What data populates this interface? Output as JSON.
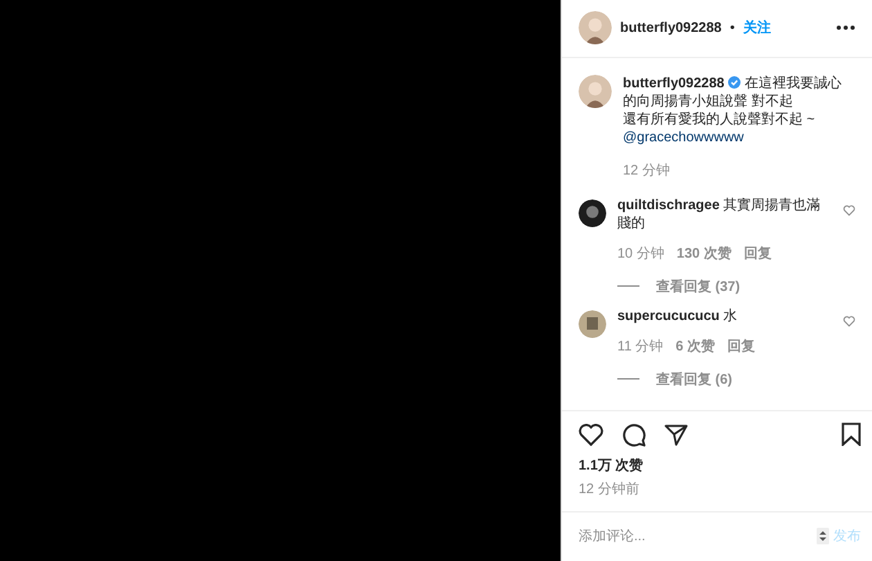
{
  "post": {
    "author": {
      "username": "butterfly092288",
      "separator": "•",
      "follow": "关注"
    },
    "caption": {
      "username": "butterfly092288",
      "verified": true,
      "text": "在這裡我要誠心的向周揚青小姐說聲 對不起",
      "text_2": "還有所有愛我的人說聲對不起 ~",
      "mention": "@gracechowwwww",
      "time": "12 分钟"
    },
    "comments": [
      {
        "username": "quiltdischragee",
        "text": "其實周揚青也滿賤的",
        "time": "10 分钟",
        "likes": "130 次赞",
        "reply": "回复",
        "view_replies": "查看回复 (37)",
        "liked": false
      },
      {
        "username": "supercucucucu",
        "text": "水",
        "time": "11 分钟",
        "likes": "6 次赞",
        "reply": "回复",
        "view_replies": "查看回复 (6)",
        "liked": false
      }
    ],
    "likes": "1.1万 次赞",
    "posted": "12 分钟前",
    "saved": false,
    "comment_field": {
      "placeholder": "添加评论...",
      "submit": "发布"
    }
  }
}
